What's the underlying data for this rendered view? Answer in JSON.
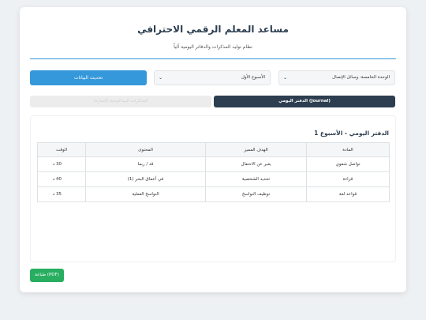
{
  "header": {
    "title": "مساعد المعلم الرقمي الاحترافي",
    "subtitle": "نظام توليد المذكرات والدفاتر اليومية آلياً"
  },
  "controls": {
    "update_button": "تحديث البيانات",
    "week_select": "الأسبوع الأول",
    "unit_select": "الوحدة الخامسة: وسائل الإتصال"
  },
  "tabs": {
    "journal": "الدفتر اليومي (Journal)",
    "other": "المذكرات البيداغوجية (المدرّة)"
  },
  "panel": {
    "title": "الدفتر اليومي - الأسبوع 1",
    "columns": [
      "المادة",
      "الهدف المميز",
      "المحتوى",
      "الوقت"
    ],
    "rows": [
      [
        "تواصل شفوي",
        "يعبر عن الاحتفال",
        "قد / ربما",
        "30 د"
      ],
      [
        "قراءة",
        "تحديد الشخصية",
        "في أعماق البحر (1)",
        "40 د"
      ],
      [
        "قواعد لغة",
        "توظيف النواسخ",
        "النواسخ الفعلية",
        "35 د"
      ]
    ]
  },
  "footer": {
    "print_button": "طباعة (PDF)"
  },
  "colors": {
    "primary_blue": "#3498db",
    "dark_navy": "#2c3e50",
    "success_green": "#27ae60"
  }
}
